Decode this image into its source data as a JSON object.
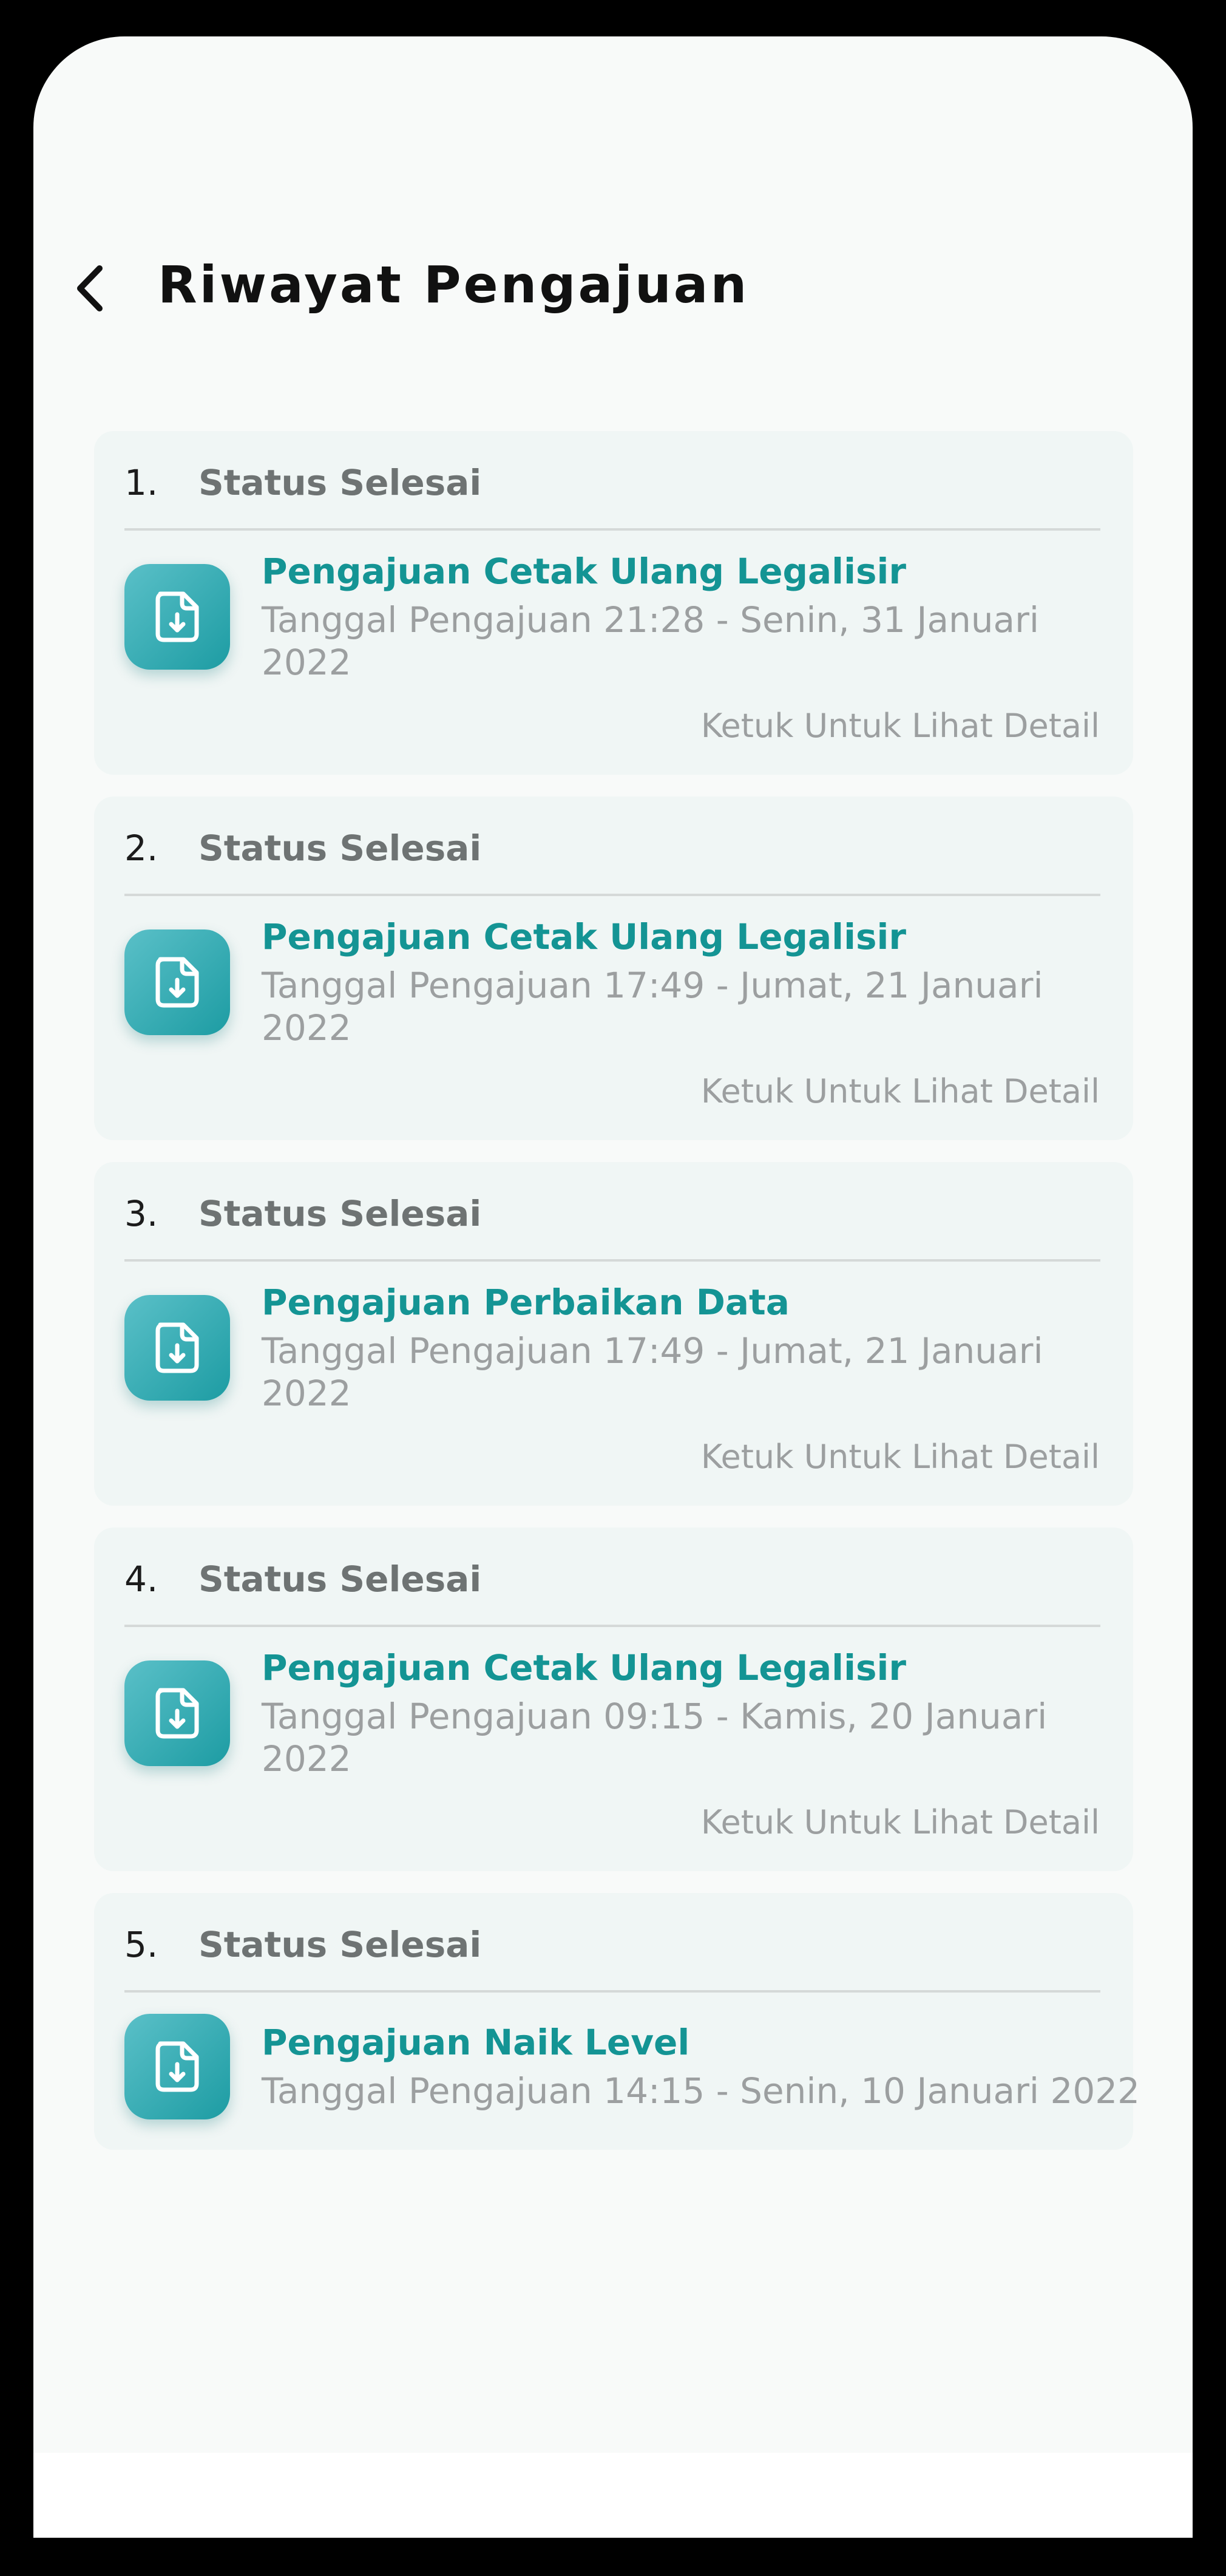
{
  "header": {
    "title": "Riwayat Pengajuan"
  },
  "icons": {
    "back": "chevron-left-icon",
    "document": "document-download-icon"
  },
  "colors": {
    "title_accent": "#149494",
    "icon_gradient_start": "#5AC0C8",
    "icon_gradient_end": "#1D9CA3",
    "card_background": "#F0F6F5",
    "muted_text": "#9C9FA0"
  },
  "submissions": [
    {
      "number": "1.",
      "status": "Status Selesai",
      "title": "Pengajuan Cetak Ulang Legalisir",
      "date": "Tanggal Pengajuan 21:28 - Senin, 31 Januari 2022",
      "detail_hint": "Ketuk Untuk Lihat Detail"
    },
    {
      "number": "2.",
      "status": "Status Selesai",
      "title": "Pengajuan Cetak Ulang Legalisir",
      "date": "Tanggal Pengajuan 17:49 - Jumat, 21 Januari 2022",
      "detail_hint": "Ketuk Untuk Lihat Detail"
    },
    {
      "number": "3.",
      "status": "Status Selesai",
      "title": "Pengajuan Perbaikan Data",
      "date": "Tanggal Pengajuan 17:49 - Jumat, 21 Januari 2022",
      "detail_hint": "Ketuk Untuk Lihat Detail"
    },
    {
      "number": "4.",
      "status": "Status Selesai",
      "title": "Pengajuan Cetak Ulang Legalisir",
      "date": "Tanggal Pengajuan 09:15 - Kamis, 20 Januari 2022",
      "detail_hint": "Ketuk Untuk Lihat Detail"
    },
    {
      "number": "5.",
      "status": "Status Selesai",
      "title": "Pengajuan Naik Level",
      "date": "Tanggal Pengajuan 14:15 - Senin, 10 Januari 2022"
    }
  ]
}
